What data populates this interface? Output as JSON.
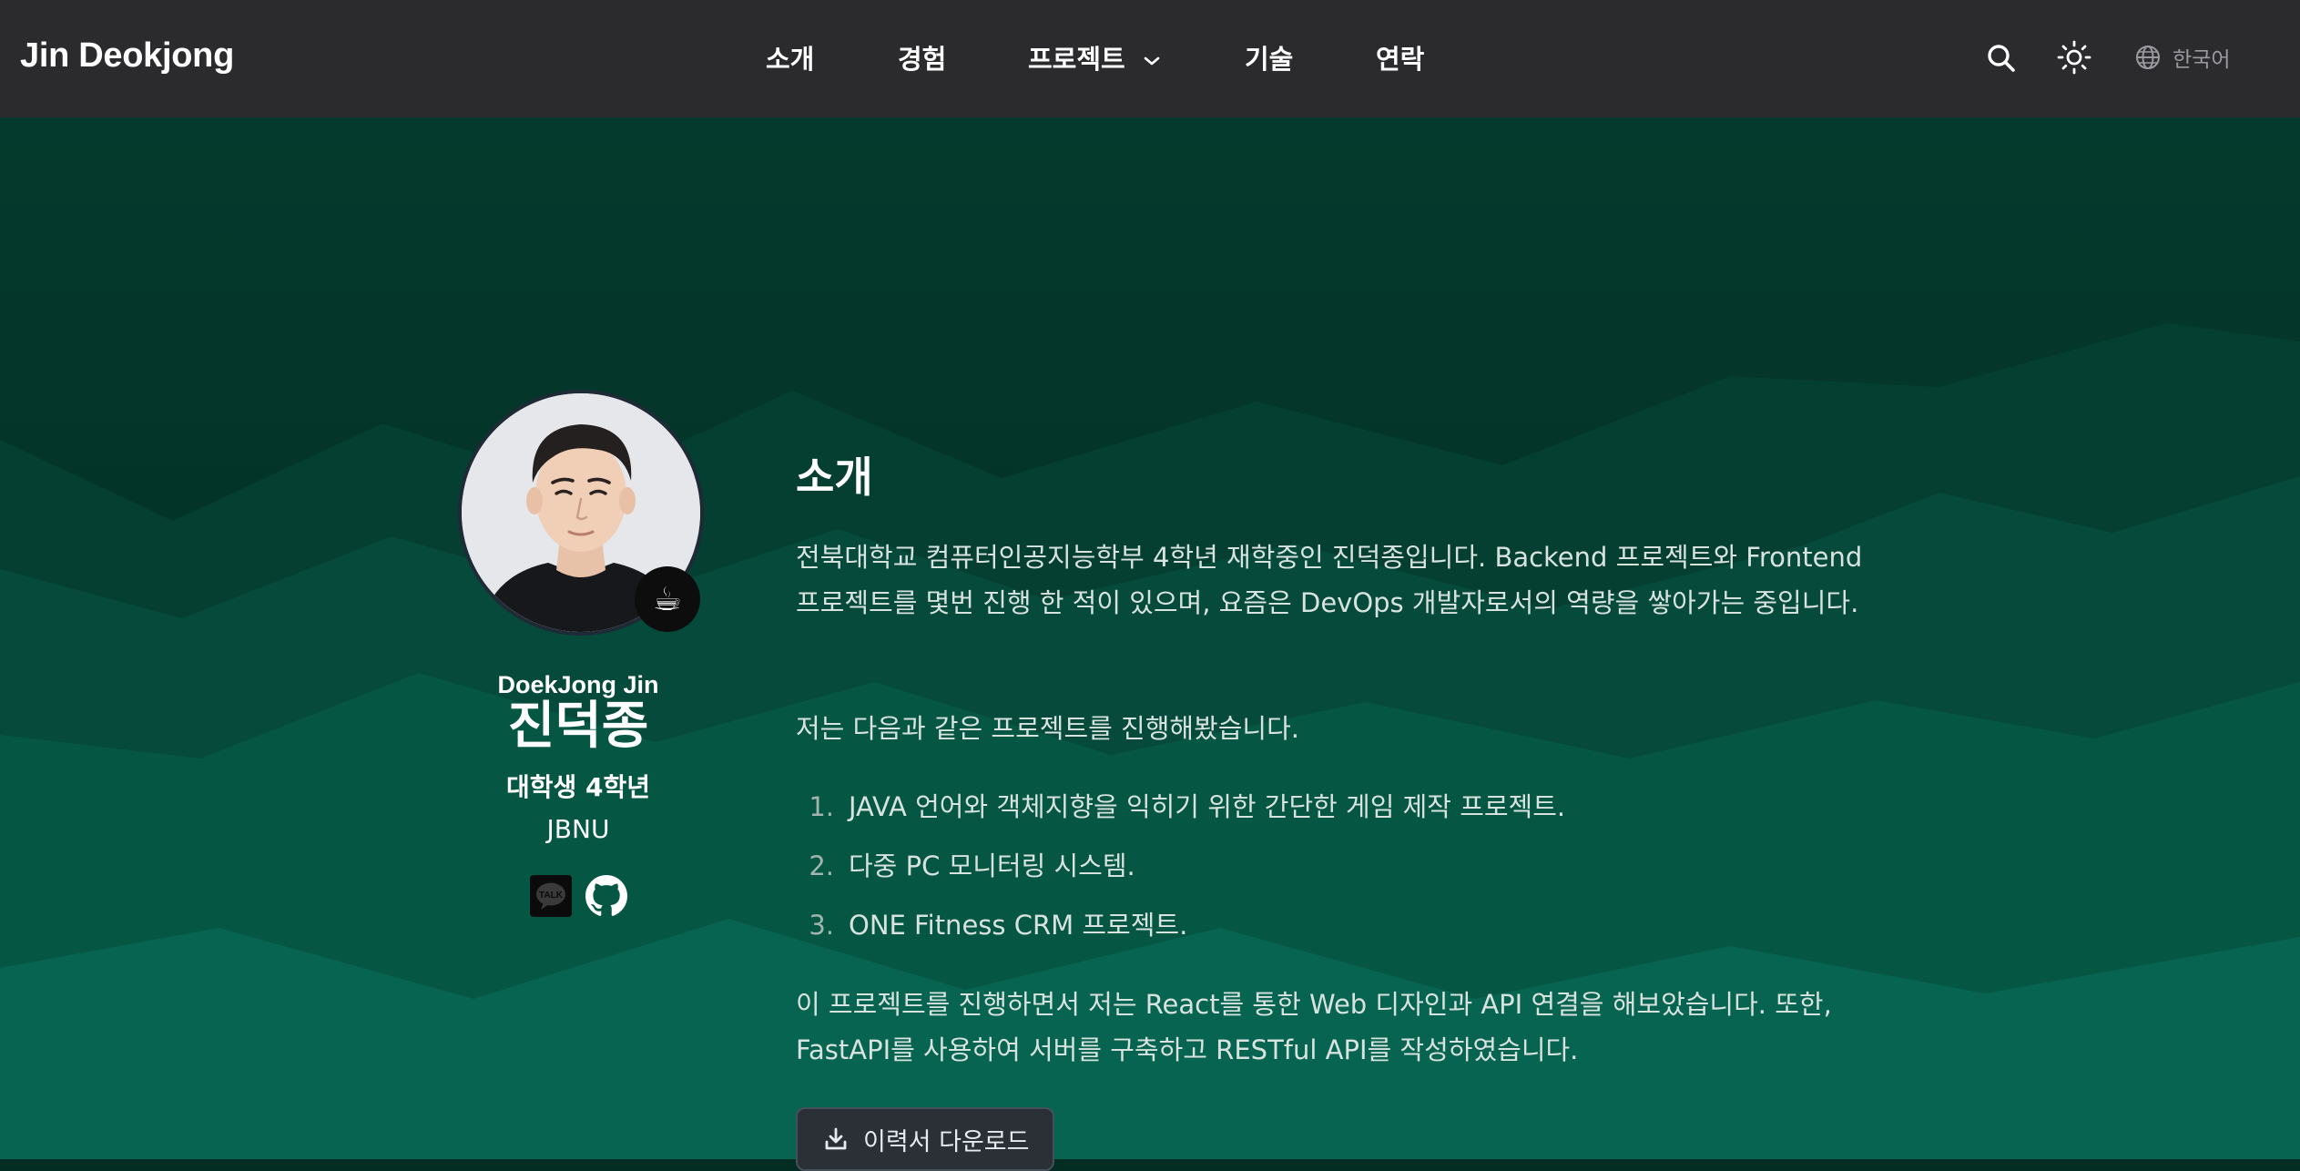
{
  "header": {
    "brand": "Jin Deokjong",
    "nav": [
      {
        "label": "소개"
      },
      {
        "label": "경험"
      },
      {
        "label": "프로젝트",
        "has_dropdown": true
      },
      {
        "label": "기술"
      },
      {
        "label": "연락"
      }
    ],
    "language": "한국어",
    "icons": [
      "search-icon",
      "sun-icon",
      "globe-icon"
    ]
  },
  "profile": {
    "name_en": "DoekJong Jin",
    "name_ko": "진덕종",
    "role": "대학생 4학년",
    "school": "JBNU",
    "badge_icon": "coffee-cup-icon",
    "socials": [
      "kakaotalk-icon",
      "github-icon"
    ]
  },
  "about": {
    "title": "소개",
    "intro": "전북대학교 컴퓨터인공지능학부 4학년 재학중인 진덕종입니다. Backend 프로젝트와 Frontend 프로젝트를 몇번 진행 한 적이 있으며, 요즘은 DevOps 개발자로서의 역량을 쌓아가는 중입니다.",
    "projects_intro": "저는 다음과 같은 프로젝트를 진행해봤습니다.",
    "projects": [
      {
        "num": "1.",
        "text": "JAVA 언어와 객체지향을 익히기 위한 간단한 게임 제작 프로젝트."
      },
      {
        "num": "2.",
        "text": "다중 PC 모니터링 시스템."
      },
      {
        "num": "3.",
        "text": "ONE Fitness CRM 프로젝트."
      }
    ],
    "summary": "이 프로젝트를 진행하면서 저는 React를 통한 Web 디자인과 API 연결을 해보았습니다. 또한, FastAPI를 사용하여 서버를 구축하고 RESTful API를 작성하였습니다.",
    "download_label": "이력서 다운로드"
  },
  "colors": {
    "header_bg": "#2b2b2d",
    "hero_top": "#032d22",
    "hero_mid": "#04473a",
    "hero_bottom": "#06604d",
    "text_muted": "#d8e2de"
  }
}
